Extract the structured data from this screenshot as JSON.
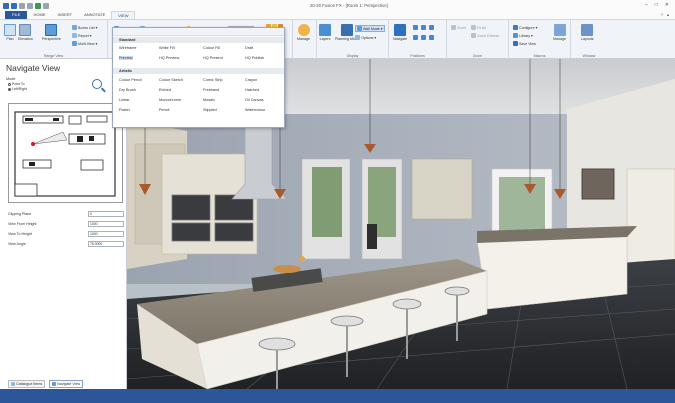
{
  "window": {
    "title": "20-20 Fusion FX - [Room 1: Perspective]",
    "controls": [
      "–",
      "□",
      "✕"
    ]
  },
  "tabs": [
    {
      "label": "FILE"
    },
    {
      "label": "HOME"
    },
    {
      "label": "INSERT"
    },
    {
      "label": "ANNOTATE"
    },
    {
      "label": "VIEW"
    }
  ],
  "ribbon": {
    "range_view": {
      "label": "Range View",
      "buttons": [
        "Plan",
        "Elevation",
        "Perspective"
      ],
      "small": [
        "Boxes List ▾",
        "Report ▾",
        "Multi-View ▾"
      ]
    },
    "render_controls": {
      "setting": "Setting ▾",
      "backgrounds": "Backgrounds ▾",
      "sunlight": "Sunlight",
      "value": "38"
    },
    "manage": "Manage",
    "display": {
      "label": "Display",
      "buttons": [
        "Layers",
        "Planning Mode"
      ],
      "small": [
        "Wall Mode ▾",
        "Options ▾"
      ]
    },
    "positions": {
      "label": "Positions",
      "buttons": [
        "Navigate"
      ]
    },
    "zoom": {
      "label": "Zoom",
      "small": [
        "Zoom",
        "Fit All",
        "Zoom Extents"
      ]
    },
    "macros": {
      "label": "Macros",
      "small": [
        "Configure ▾",
        "Library ▾",
        "Save View"
      ],
      "buttons": [
        "Manage"
      ]
    },
    "window": {
      "label": "Window",
      "buttons": [
        "Layouts"
      ]
    }
  },
  "dropdown": {
    "sections": [
      "Standard",
      "Artistic"
    ],
    "standard": [
      [
        "Wireframe",
        "White Fill",
        "Colour Fill",
        "Draft"
      ],
      [
        "Preview",
        "HQ Preview",
        "HQ Present",
        "HQ Publish"
      ]
    ],
    "artistic": [
      [
        "Colour Pencil",
        "Colour Sketch",
        "Comic Strip",
        "Crayon"
      ],
      [
        "Dry Brush",
        "Etched",
        "Freehand",
        "Hatched"
      ],
      [
        "Linear",
        "Monochrome",
        "Mosaic",
        "Oil Canvas"
      ],
      [
        "Pastel",
        "Pencil",
        "Stippled",
        "Watercolour"
      ]
    ],
    "selected": "Preview"
  },
  "left_pane": {
    "title": "Navigate View",
    "mode_label": "Mode",
    "modes": [
      "Point To",
      "Left/Right"
    ],
    "fields": [
      {
        "label": "Clipping Plane",
        "value": "0"
      },
      {
        "label": "View From Height",
        "value": "1000"
      },
      {
        "label": "View To Height",
        "value": "1000"
      },
      {
        "label": "View Angle",
        "value": "75.0000"
      }
    ],
    "bottom_tabs": [
      "Catalogue Items",
      "Navigate View"
    ]
  },
  "colors": {
    "accent": "#2b579a",
    "file_tab": "#2b5797",
    "ribbon_bg": "#f0f3f8",
    "cabinet_white": "#f2f0ea",
    "counter": "#8a8478",
    "floor": "#2b2d30"
  }
}
